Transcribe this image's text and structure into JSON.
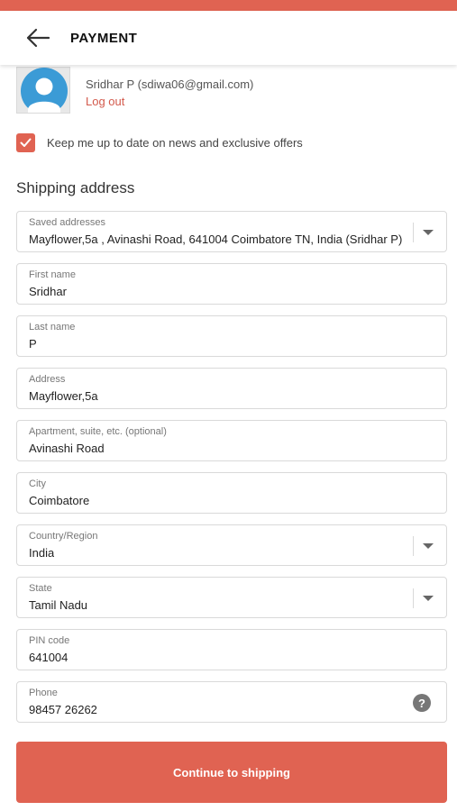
{
  "header": {
    "title": "PAYMENT",
    "back_icon": "arrow-left-icon"
  },
  "account": {
    "avatar_icon": "user-avatar-icon",
    "name_line": "Sridhar P (sdiwa06@gmail.com)",
    "logout": "Log out"
  },
  "newsletter": {
    "checked": true,
    "label": "Keep me up to date on news and exclusive offers"
  },
  "shipping": {
    "title": "Shipping address",
    "fields": [
      {
        "label": "Saved addresses",
        "value": "Mayflower,5a , Avinashi Road, 641004 Coimbatore TN, India (Sridhar P)",
        "type": "select"
      },
      {
        "label": "First name",
        "value": "Sridhar",
        "type": "text"
      },
      {
        "label": "Last name",
        "value": "P",
        "type": "text"
      },
      {
        "label": "Address",
        "value": "Mayflower,5a",
        "type": "text"
      },
      {
        "label": "Apartment, suite, etc. (optional)",
        "value": "Avinashi Road",
        "type": "text"
      },
      {
        "label": "City",
        "value": "Coimbatore",
        "type": "text"
      },
      {
        "label": "Country/Region",
        "value": "India",
        "type": "select"
      },
      {
        "label": "State",
        "value": "Tamil Nadu",
        "type": "select"
      },
      {
        "label": "PIN code",
        "value": "641004",
        "type": "text"
      },
      {
        "label": "Phone",
        "value": "98457 26262",
        "type": "tel",
        "help_icon": "question-circle-icon",
        "help_glyph": "?"
      }
    ]
  },
  "cta": {
    "label": "Continue to shipping"
  },
  "colors": {
    "accent": "#e06352",
    "link": "#d35a4c",
    "border": "#d9d9d9"
  }
}
